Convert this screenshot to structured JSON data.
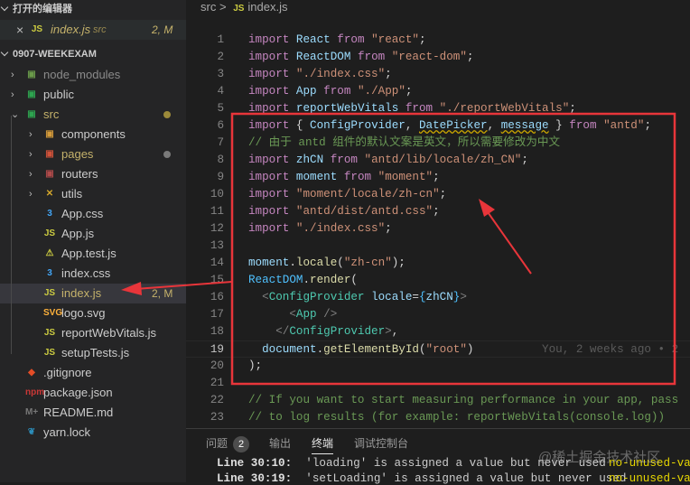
{
  "sidebar": {
    "open_editors_title": "打开的编辑器",
    "open_editor": {
      "close": "×",
      "icon": "JS",
      "name": "index.js",
      "dir": "src",
      "status": "2, M"
    },
    "project_title": "0907-WEEKEXAM",
    "items": [
      {
        "label": "node_modules",
        "depth": 0,
        "folder": true,
        "icon": "▣",
        "icon_color": "#6a9a4a",
        "color": "#8b8b8b"
      },
      {
        "label": "public",
        "depth": 0,
        "folder": true,
        "icon": "▣",
        "icon_color": "#2ea44f",
        "color": "#ccc"
      },
      {
        "label": "src",
        "depth": 0,
        "folder": true,
        "open": true,
        "icon": "▣",
        "icon_color": "#2ea44f",
        "color": "#c5b26b",
        "dot": "#9c8a3a"
      },
      {
        "label": "components",
        "depth": 1,
        "folder": true,
        "icon": "▣",
        "icon_color": "#d49a3a",
        "color": "#ccc"
      },
      {
        "label": "pages",
        "depth": 1,
        "folder": true,
        "icon": "▣",
        "icon_color": "#d0523a",
        "color": "#c5b26b",
        "dot": "#7a7a7a"
      },
      {
        "label": "routers",
        "depth": 1,
        "folder": true,
        "icon": "▣",
        "icon_color": "#b04a4a",
        "color": "#ccc"
      },
      {
        "label": "utils",
        "depth": 1,
        "folder": true,
        "icon": "✕",
        "icon_color": "#d4a72c",
        "color": "#ccc"
      },
      {
        "label": "App.css",
        "depth": 1,
        "icon": "3",
        "icon_color": "#42a5f5",
        "color": "#ccc"
      },
      {
        "label": "App.js",
        "depth": 1,
        "icon": "JS",
        "icon_color": "#cbcb41",
        "color": "#ccc"
      },
      {
        "label": "App.test.js",
        "depth": 1,
        "icon": "⚠",
        "icon_color": "#cbcb41",
        "color": "#ccc"
      },
      {
        "label": "index.css",
        "depth": 1,
        "icon": "3",
        "icon_color": "#42a5f5",
        "color": "#ccc"
      },
      {
        "label": "index.js",
        "depth": 1,
        "icon": "JS",
        "icon_color": "#cbcb41",
        "color": "#c5b26b",
        "selected": true,
        "status": "2, M"
      },
      {
        "label": "logo.svg",
        "depth": 1,
        "icon": "SVG",
        "icon_color": "#ffb13b",
        "color": "#ccc"
      },
      {
        "label": "reportWebVitals.js",
        "depth": 1,
        "icon": "JS",
        "icon_color": "#cbcb41",
        "color": "#ccc"
      },
      {
        "label": "setupTests.js",
        "depth": 1,
        "icon": "JS",
        "icon_color": "#cbcb41",
        "color": "#ccc"
      },
      {
        "label": ".gitignore",
        "depth": 0,
        "icon": "◆",
        "icon_color": "#e44d26",
        "color": "#ccc"
      },
      {
        "label": "package.json",
        "depth": 0,
        "icon": "npm",
        "icon_color": "#cb3837",
        "color": "#ccc"
      },
      {
        "label": "README.md",
        "depth": 0,
        "icon": "M+",
        "icon_color": "#777",
        "color": "#ccc"
      },
      {
        "label": "yarn.lock",
        "depth": 0,
        "icon": "❦",
        "icon_color": "#2c8ebb",
        "color": "#ccc"
      }
    ]
  },
  "editor": {
    "breadcrumb": {
      "folder": "src",
      "sep": ">",
      "icon": "JS",
      "file": "index.js"
    },
    "current_line": 19,
    "lines": [
      [
        [
          "k",
          "import"
        ],
        [
          "p",
          " "
        ],
        [
          "v",
          "React"
        ],
        [
          "p",
          " "
        ],
        [
          "k",
          "from"
        ],
        [
          "p",
          " "
        ],
        [
          "s",
          "\"react\""
        ],
        [
          "p",
          ";"
        ]
      ],
      [
        [
          "k",
          "import"
        ],
        [
          "p",
          " "
        ],
        [
          "v",
          "ReactDOM"
        ],
        [
          "p",
          " "
        ],
        [
          "k",
          "from"
        ],
        [
          "p",
          " "
        ],
        [
          "s",
          "\"react-dom\""
        ],
        [
          "p",
          ";"
        ]
      ],
      [
        [
          "k",
          "import"
        ],
        [
          "p",
          " "
        ],
        [
          "s",
          "\"./index.css\""
        ],
        [
          "p",
          ";"
        ]
      ],
      [
        [
          "k",
          "import"
        ],
        [
          "p",
          " "
        ],
        [
          "v",
          "App"
        ],
        [
          "p",
          " "
        ],
        [
          "k",
          "from"
        ],
        [
          "p",
          " "
        ],
        [
          "s",
          "\"./App\""
        ],
        [
          "p",
          ";"
        ]
      ],
      [
        [
          "k",
          "import"
        ],
        [
          "p",
          " "
        ],
        [
          "v",
          "reportWebVitals"
        ],
        [
          "p",
          " "
        ],
        [
          "k",
          "from"
        ],
        [
          "p",
          " "
        ],
        [
          "s",
          "\"./reportWebVitals\""
        ],
        [
          "p",
          ";"
        ]
      ],
      [
        [
          "k",
          "import"
        ],
        [
          "p",
          " { "
        ],
        [
          "v",
          "ConfigProvider"
        ],
        [
          "p",
          ", "
        ],
        [
          "v w",
          "DatePicker"
        ],
        [
          "p",
          ", "
        ],
        [
          "v w",
          "message"
        ],
        [
          "p",
          " } "
        ],
        [
          "k",
          "from"
        ],
        [
          "p",
          " "
        ],
        [
          "s",
          "\"antd\""
        ],
        [
          "p",
          ";"
        ]
      ],
      [
        [
          "c",
          "// 由于 antd 组件的默认文案是英文，所以需要修改为中文"
        ]
      ],
      [
        [
          "k",
          "import"
        ],
        [
          "p",
          " "
        ],
        [
          "v",
          "zhCN"
        ],
        [
          "p",
          " "
        ],
        [
          "k",
          "from"
        ],
        [
          "p",
          " "
        ],
        [
          "s",
          "\"antd/lib/locale/zh_CN\""
        ],
        [
          "p",
          ";"
        ]
      ],
      [
        [
          "k",
          "import"
        ],
        [
          "p",
          " "
        ],
        [
          "v",
          "moment"
        ],
        [
          "p",
          " "
        ],
        [
          "k",
          "from"
        ],
        [
          "p",
          " "
        ],
        [
          "s",
          "\"moment\""
        ],
        [
          "p",
          ";"
        ]
      ],
      [
        [
          "k",
          "import"
        ],
        [
          "p",
          " "
        ],
        [
          "s",
          "\"moment/locale/zh-cn\""
        ],
        [
          "p",
          ";"
        ]
      ],
      [
        [
          "k",
          "import"
        ],
        [
          "p",
          " "
        ],
        [
          "s",
          "\"antd/dist/antd.css\""
        ],
        [
          "p",
          ";"
        ]
      ],
      [
        [
          "k",
          "import"
        ],
        [
          "p",
          " "
        ],
        [
          "s",
          "\"./index.css\""
        ],
        [
          "p",
          ";"
        ]
      ],
      [],
      [
        [
          "v",
          "moment"
        ],
        [
          "p",
          "."
        ],
        [
          "f",
          "locale"
        ],
        [
          "p",
          "("
        ],
        [
          "s",
          "\"zh-cn\""
        ],
        [
          "p",
          ");"
        ]
      ],
      [
        [
          "b",
          "ReactDOM"
        ],
        [
          "p",
          "."
        ],
        [
          "f",
          "render"
        ],
        [
          "p",
          "("
        ]
      ],
      [
        [
          "p",
          "  "
        ],
        [
          "g",
          "<"
        ],
        [
          "t",
          "ConfigProvider"
        ],
        [
          "p",
          " "
        ],
        [
          "v",
          "locale"
        ],
        [
          "p",
          "="
        ],
        [
          "b",
          "{"
        ],
        [
          "v",
          "zhCN"
        ],
        [
          "b",
          "}"
        ],
        [
          "g",
          ">"
        ]
      ],
      [
        [
          "p",
          "      "
        ],
        [
          "g",
          "<"
        ],
        [
          "t",
          "App"
        ],
        [
          "p",
          " "
        ],
        [
          "g",
          "/>"
        ]
      ],
      [
        [
          "p",
          "    "
        ],
        [
          "g",
          "</"
        ],
        [
          "t",
          "ConfigProvider"
        ],
        [
          "g",
          ">"
        ],
        [
          "p",
          ","
        ]
      ],
      [
        [
          "p",
          "  "
        ],
        [
          "v",
          "document"
        ],
        [
          "p",
          "."
        ],
        [
          "f",
          "getElementById"
        ],
        [
          "p",
          "("
        ],
        [
          "s",
          "\"root\""
        ],
        [
          "p",
          ")"
        ],
        [
          "blame",
          "          You, 2 weeks ago • 2"
        ]
      ],
      [
        [
          "p",
          ");"
        ]
      ],
      [],
      [
        [
          "c",
          "// If you want to start measuring performance in your app, pass"
        ]
      ],
      [
        [
          "c",
          "// to log results (for example: reportWebVitals(console.log))"
        ]
      ]
    ]
  },
  "panel": {
    "tabs": [
      {
        "label": "问题",
        "badge": "2"
      },
      {
        "label": "输出"
      },
      {
        "label": "终端",
        "active": true
      },
      {
        "label": "调试控制台"
      }
    ],
    "messages": [
      {
        "loc": "Line 30:10:",
        "text": "'loading' is assigned a value but never used",
        "rule": "no-unused-vars"
      },
      {
        "loc": "Line 30:19:",
        "text": "'setLoading' is assigned a value but never used",
        "rule": "no-unused-vars"
      }
    ],
    "watermark": "@稀土掘金技术社区"
  },
  "annotation_color": "#e8353a"
}
